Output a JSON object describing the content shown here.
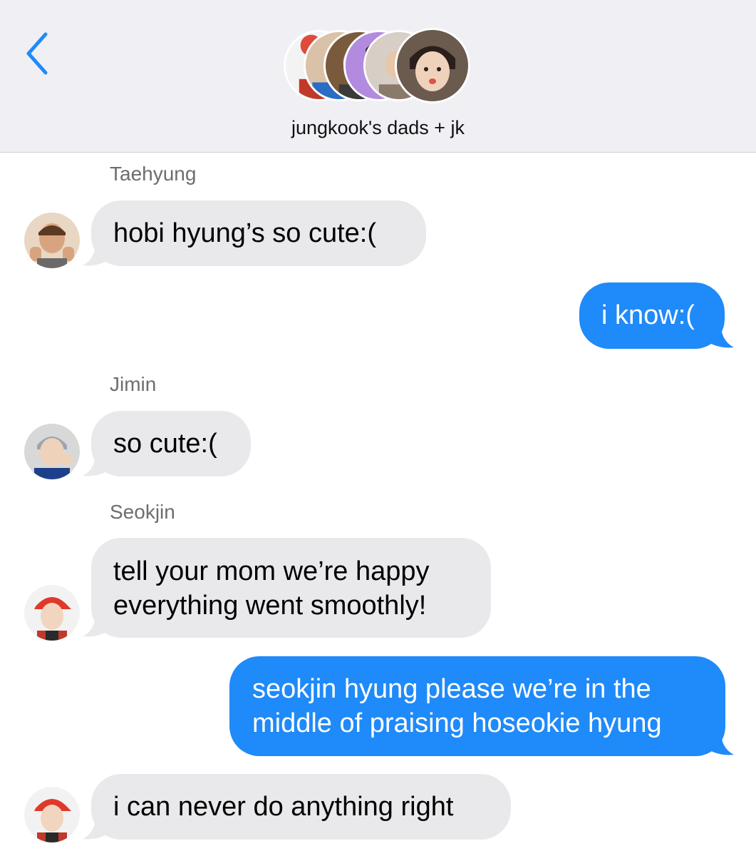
{
  "header": {
    "back_icon": "chevron-left-icon",
    "group_title": "jungkook's dads + jk",
    "accent_color": "#1f8af9"
  },
  "messages": [
    {
      "sender": "Taehyung",
      "direction": "incoming",
      "text": "hobi hyung’s so cute:("
    },
    {
      "sender": "me",
      "direction": "outgoing",
      "text": "i know:("
    },
    {
      "sender": "Jimin",
      "direction": "incoming",
      "text": "so cute:("
    },
    {
      "sender": "Seokjin",
      "direction": "incoming",
      "lines": [
        "tell your mom we’re happy",
        "everything went smoothly!"
      ]
    },
    {
      "sender": "me",
      "direction": "outgoing",
      "lines": [
        "seokjin hyung please we’re in the",
        "middle of praising hoseokie hyung"
      ]
    },
    {
      "sender": "Seokjin",
      "direction": "incoming",
      "text": "i can never do anything right"
    }
  ],
  "colors": {
    "incoming_bubble": "#e9e9eb",
    "outgoing_bubble": "#1f8af9",
    "header_background": "#f0eff4",
    "sender_name": "#6d6d72"
  }
}
